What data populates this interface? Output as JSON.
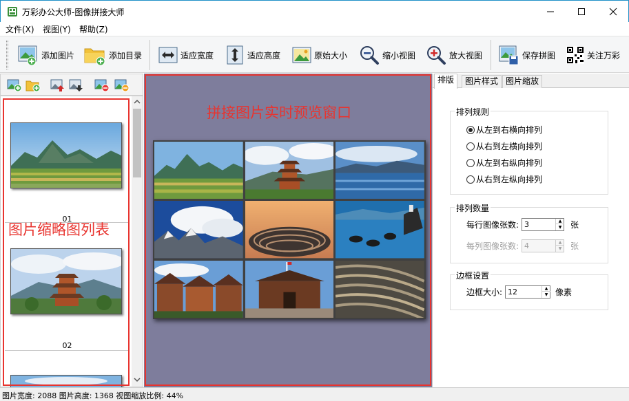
{
  "window": {
    "title": "万彩办公大师-图像拼接大师",
    "minimize_glyph": "—",
    "maximize_glyph": "☐",
    "close_glyph": "✕"
  },
  "menu": [
    {
      "label": "文件(X)"
    },
    {
      "label": "视图(Y)"
    },
    {
      "label": "帮助(Z)"
    }
  ],
  "toolbar": {
    "add_image": "添加图片",
    "add_folder": "添加目录",
    "fit_width": "适应宽度",
    "fit_height": "适应高度",
    "original_size": "原始大小",
    "zoom_out": "缩小视图",
    "zoom_in": "放大视图",
    "save": "保存拼图",
    "follow": "关注万彩"
  },
  "thumbnails": [
    {
      "label": "01",
      "icon": "landscape-mountains-thumbnail"
    },
    {
      "label": "02",
      "icon": "pagoda-thumbnail"
    }
  ],
  "annotations": {
    "preview": "拼接图片实时预览窗口",
    "thumbnails": "图片缩略图列表"
  },
  "tabs": [
    {
      "label": "排版",
      "active": true
    },
    {
      "label": "图片样式",
      "active": false
    },
    {
      "label": "图片缩放",
      "active": false
    }
  ],
  "layout": {
    "rule_group": {
      "title": "排列规则",
      "options": [
        {
          "label": "从左到右横向排列",
          "selected": true
        },
        {
          "label": "从右到左横向排列",
          "selected": false
        },
        {
          "label": "从左到右纵向排列",
          "selected": false
        },
        {
          "label": "从右到左纵向排列",
          "selected": false
        }
      ]
    },
    "count_group": {
      "title": "排列数量",
      "per_row_label": "每行图像张数:",
      "per_row_value": "3",
      "per_row_unit": "张",
      "per_col_label": "每列图像张数:",
      "per_col_value": "4",
      "per_col_unit": "张"
    },
    "border_group": {
      "title": "边框设置",
      "size_label": "边框大小:",
      "size_value": "12",
      "size_unit": "像素"
    }
  },
  "status": {
    "text": "图片宽度: 2088 图片高度: 1368 视图缩放比例: 44%"
  },
  "colors": {
    "preview_bg": "#7e7d9c",
    "annotation_red": "#e8342f"
  }
}
